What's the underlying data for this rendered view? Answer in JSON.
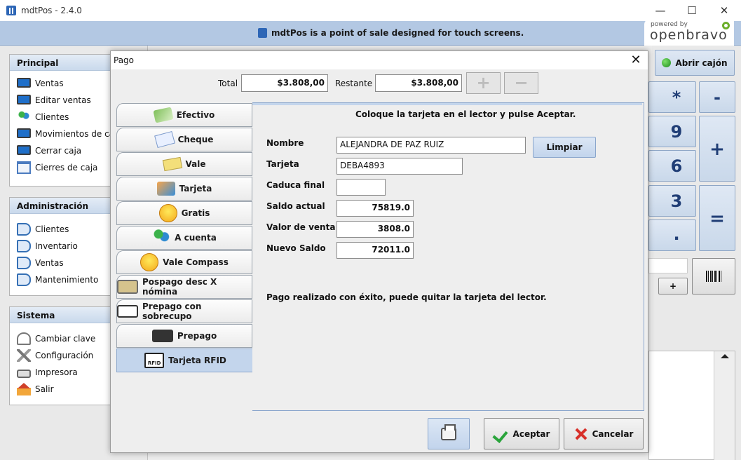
{
  "window": {
    "title": "mdtPos - 2.4.0",
    "controls": {
      "minimize": "—",
      "maximize": "☐",
      "close": "✕"
    }
  },
  "banner": {
    "text": "mdtPos is a point of sale designed for touch screens.",
    "logo_powered": "powered by",
    "logo_name": "openbravo"
  },
  "sidebar": {
    "principal": {
      "title": "Principal",
      "items": [
        {
          "label": "Ventas",
          "icon": "monitor-icon"
        },
        {
          "label": "Editar ventas",
          "icon": "monitor-icon"
        },
        {
          "label": "Clientes",
          "icon": "people-icon"
        },
        {
          "label": "Movimientos de caja",
          "icon": "monitor-icon"
        },
        {
          "label": "Cerrar caja",
          "icon": "monitor-icon"
        },
        {
          "label": "Cierres de caja",
          "icon": "calendar-icon"
        }
      ]
    },
    "administracion": {
      "title": "Administración",
      "items": [
        {
          "label": "Clientes",
          "icon": "book-icon"
        },
        {
          "label": "Inventario",
          "icon": "book-icon"
        },
        {
          "label": "Ventas",
          "icon": "book-icon"
        },
        {
          "label": "Mantenimiento",
          "icon": "book-icon"
        }
      ]
    },
    "sistema": {
      "title": "Sistema",
      "items": [
        {
          "label": "Cambiar clave",
          "icon": "key-icon"
        },
        {
          "label": "Configuración",
          "icon": "tools-icon"
        },
        {
          "label": "Impresora",
          "icon": "printer-icon"
        },
        {
          "label": "Salir",
          "icon": "home-icon"
        }
      ]
    }
  },
  "keypad": {
    "open_drawer": "Abrir cajón",
    "keys": {
      "multiply": "*",
      "minus": "-",
      "nine": "9",
      "six": "6",
      "three": "3",
      "dot": ".",
      "plus": "+",
      "equals": "=",
      "small_plus": "+"
    }
  },
  "dialog": {
    "title": "Pago",
    "close": "✕",
    "total_label": "Total",
    "total_value": "$3.808,00",
    "remaining_label": "Restante",
    "remaining_value": "$3.808,00",
    "add_button": "+",
    "remove_button": "−",
    "tabs": [
      {
        "label": "Efectivo",
        "icon": "cash-icon"
      },
      {
        "label": "Cheque",
        "icon": "cheque-icon"
      },
      {
        "label": "Vale",
        "icon": "voucher-icon"
      },
      {
        "label": "Tarjeta",
        "icon": "card-icon"
      },
      {
        "label": "Gratis",
        "icon": "smiley-icon"
      },
      {
        "label": "A cuenta",
        "icon": "people-icon"
      },
      {
        "label": "Vale Compass",
        "icon": "smiley-icon"
      },
      {
        "label": "Pospago desc X nómina",
        "icon": "pospago-card-icon"
      },
      {
        "label": "Prepago con sobrecupo",
        "icon": "prepago-card-icon"
      },
      {
        "label": "Prepago",
        "icon": "chip-card-icon"
      },
      {
        "label": "Tarjeta RFID",
        "icon": "rfid-card-icon"
      }
    ],
    "selected_tab": "Tarjeta RFID",
    "instruction": "Coloque la tarjeta en el lector y pulse Aceptar.",
    "form": {
      "name_label": "Nombre",
      "name_value": "ALEJANDRA DE PAZ RUIZ",
      "clear_button": "Limpiar",
      "card_label": "Tarjeta",
      "card_value": "DEBA4893",
      "expiry_label": "Caduca final",
      "expiry_value": "",
      "balance_label": "Saldo actual",
      "balance_value": "75819.0",
      "sale_label": "Valor de venta",
      "sale_value": "3808.0",
      "new_balance_label": "Nuevo Saldo",
      "new_balance_value": "72011.0"
    },
    "success_message": "Pago realizado con éxito, puede quitar la tarjeta del lector.",
    "accept_button": "Aceptar",
    "cancel_button": "Cancelar"
  }
}
